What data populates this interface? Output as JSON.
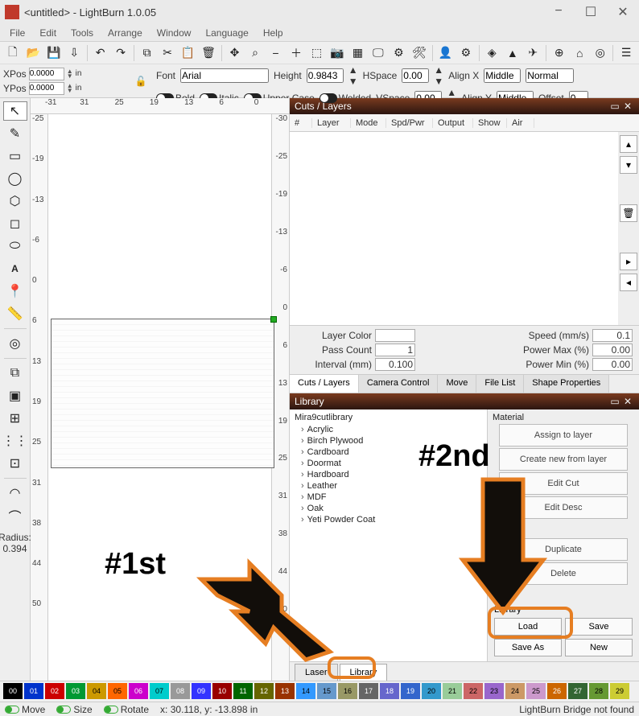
{
  "title": "<untitled> - LightBurn 1.0.05",
  "menu": [
    "File",
    "Edit",
    "Tools",
    "Arrange",
    "Window",
    "Language",
    "Help"
  ],
  "coords": {
    "xpos_label": "XPos",
    "ypos_label": "YPos",
    "xpos": "0.0000",
    "ypos": "0.0000",
    "unit": "in"
  },
  "font_row": {
    "font_label": "Font",
    "font": "Arial",
    "height_label": "Height",
    "height": "0.9843",
    "hspace_label": "HSpace",
    "hspace": "0.00",
    "alignx_label": "Align X",
    "alignx": "Middle",
    "normal": "Normal"
  },
  "font_row2": {
    "bold": "Bold",
    "italic": "Italic",
    "upper": "Upper Case",
    "welded": "Welded",
    "vspace_label": "VSpace",
    "vspace": "0.00",
    "aligny_label": "Align Y",
    "aligny": "Middle",
    "offset_label": "Offset",
    "offset": "0"
  },
  "radius_label": "Radius:",
  "radius_val": "0.394",
  "ruler_top": [
    "-31",
    "31",
    "25",
    "19",
    "13",
    "6",
    "0"
  ],
  "ruler_top_r": [
    "-31",
    "-25",
    "-19",
    "-13",
    "-6",
    "0",
    "6",
    "13",
    "19",
    "25",
    "31",
    "38",
    "44",
    "50",
    "",
    "31",
    "25",
    "19",
    "13",
    "6",
    "0"
  ],
  "cuts": {
    "title": "Cuts / Layers",
    "cols": [
      "#",
      "Layer",
      "Mode",
      "Spd/Pwr",
      "Output",
      "Show",
      "Air"
    ],
    "layer_color": "Layer Color",
    "pass_count": "Pass Count",
    "pass_val": "1",
    "interval": "Interval (mm)",
    "interval_val": "0.100",
    "speed": "Speed (mm/s)",
    "speed_val": "0.1",
    "pmax": "Power Max (%)",
    "pmax_val": "0.00",
    "pmin": "Power Min (%)",
    "pmin_val": "0.00"
  },
  "mid_tabs": [
    "Cuts / Layers",
    "Camera Control",
    "Move",
    "File List",
    "Shape Properties"
  ],
  "library": {
    "title": "Library",
    "root": "Mira9cutlibrary",
    "mat_label": "Material",
    "items": [
      "Acrylic",
      "Birch Plywood",
      "Cardboard",
      "Doormat",
      "Hardboard",
      "Leather",
      "MDF",
      "Oak",
      "Yeti Powder Coat"
    ],
    "btns": {
      "assign": "Assign to layer",
      "createnew": "Create new from layer",
      "editcut": "Edit Cut",
      "editdesc": "Edit Desc",
      "dup": "Duplicate",
      "del": "Delete"
    },
    "file": {
      "hdr": "Library",
      "load": "Load",
      "save": "Save",
      "saveas": "Save As",
      "newb": "New"
    }
  },
  "bottom_tabs": [
    "Laser",
    "Library"
  ],
  "colors": [
    {
      "n": "00",
      "c": "#000000"
    },
    {
      "n": "01",
      "c": "#0033cc"
    },
    {
      "n": "02",
      "c": "#cc0000"
    },
    {
      "n": "03",
      "c": "#009933"
    },
    {
      "n": "04",
      "c": "#cc9900"
    },
    {
      "n": "05",
      "c": "#ff6600"
    },
    {
      "n": "06",
      "c": "#cc00cc"
    },
    {
      "n": "07",
      "c": "#00cccc"
    },
    {
      "n": "08",
      "c": "#999999"
    },
    {
      "n": "09",
      "c": "#3333ff"
    },
    {
      "n": "10",
      "c": "#990000"
    },
    {
      "n": "11",
      "c": "#006600"
    },
    {
      "n": "12",
      "c": "#666600"
    },
    {
      "n": "13",
      "c": "#993300"
    },
    {
      "n": "14",
      "c": "#3399ff"
    },
    {
      "n": "15",
      "c": "#6699cc"
    },
    {
      "n": "16",
      "c": "#999966"
    },
    {
      "n": "17",
      "c": "#666666"
    },
    {
      "n": "18",
      "c": "#6666cc"
    },
    {
      "n": "19",
      "c": "#3366cc"
    },
    {
      "n": "20",
      "c": "#3399cc"
    },
    {
      "n": "21",
      "c": "#99cc99"
    },
    {
      "n": "22",
      "c": "#cc6666"
    },
    {
      "n": "23",
      "c": "#9966cc"
    },
    {
      "n": "24",
      "c": "#cc9966"
    },
    {
      "n": "25",
      "c": "#cc99cc"
    },
    {
      "n": "26",
      "c": "#cc6600"
    },
    {
      "n": "27",
      "c": "#336633"
    },
    {
      "n": "28",
      "c": "#669933"
    },
    {
      "n": "29",
      "c": "#cccc33"
    }
  ],
  "status": {
    "move": "Move",
    "size": "Size",
    "rotate": "Rotate",
    "pos": "x: 30.118, y: -13.898 in",
    "bridge": "LightBurn Bridge not found"
  },
  "annot": {
    "first": "#1st",
    "second": "#2nd"
  }
}
